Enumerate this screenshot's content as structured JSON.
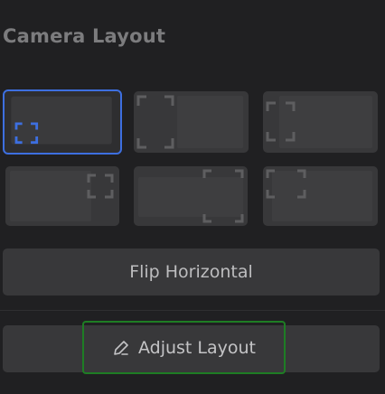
{
  "section": {
    "title": "Camera Layout"
  },
  "layouts": [
    {
      "name": "layout-bottom-left-inset",
      "selected": true
    },
    {
      "name": "layout-side-left-split",
      "selected": false
    },
    {
      "name": "layout-top-left-inset",
      "selected": false
    },
    {
      "name": "layout-top-right-inset",
      "selected": false
    },
    {
      "name": "layout-bottom-band-right",
      "selected": false
    },
    {
      "name": "layout-top-left-small",
      "selected": false
    }
  ],
  "buttons": {
    "flip_horizontal": "Flip Horizontal",
    "adjust_layout": "Adjust Layout"
  },
  "colors": {
    "selected_border": "#3d6fe0",
    "focus_outline": "#1e7d24"
  }
}
